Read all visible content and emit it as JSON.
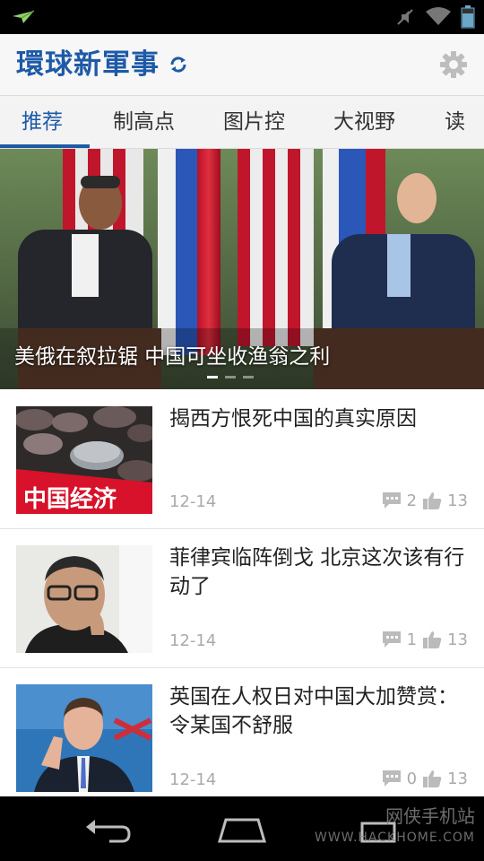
{
  "app": {
    "title": "環球新軍事"
  },
  "tabs": [
    {
      "label": "推荐",
      "active": true
    },
    {
      "label": "制高点"
    },
    {
      "label": "图片控"
    },
    {
      "label": "大视野"
    },
    {
      "label": "读"
    }
  ],
  "hero": {
    "caption": "美俄在叙拉锯 中国可坐收渔翁之利",
    "pages": 3,
    "current_page": 1
  },
  "articles": [
    {
      "title": "揭西方恨死中国的真实原因",
      "date": "12-14",
      "comments": "2",
      "likes": "13",
      "thumb_text": "中国经济"
    },
    {
      "title": "菲律宾临阵倒戈 北京这次该有行动了",
      "date": "12-14",
      "comments": "1",
      "likes": "13"
    },
    {
      "title": "英国在人权日对中国大加赞赏：令某国不舒服",
      "date": "12-14",
      "comments": "0",
      "likes": "13"
    }
  ],
  "watermark": {
    "line1": "网侠手机站",
    "line2": "WWW.HACKHOME.COM"
  },
  "colors": {
    "accent": "#1d5aa7",
    "meta": "#aaaaaa"
  },
  "icons": {
    "status": [
      "notification-icon",
      "mute-icon",
      "wifi-icon",
      "battery-icon"
    ],
    "header": [
      "refresh-icon",
      "gear-icon"
    ],
    "meta": [
      "comment-icon",
      "thumbs-up-icon"
    ],
    "nav": [
      "back-icon",
      "home-icon",
      "recents-icon"
    ]
  }
}
